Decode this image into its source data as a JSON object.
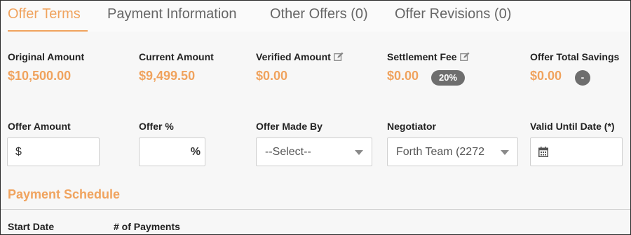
{
  "tabs": [
    {
      "label": "Offer Terms",
      "active": true
    },
    {
      "label": "Payment Information",
      "active": false
    },
    {
      "label": "Other Offers (0)",
      "active": false
    },
    {
      "label": "Offer Revisions (0)",
      "active": false
    }
  ],
  "summary": {
    "original_amount": {
      "label": "Original Amount",
      "value": "$10,500.00"
    },
    "current_amount": {
      "label": "Current Amount",
      "value": "$9,499.50"
    },
    "verified_amount": {
      "label": "Verified Amount",
      "value": "$0.00",
      "icon": "edit-icon"
    },
    "settlement_fee": {
      "label": "Settlement Fee",
      "value": "$0.00",
      "icon": "edit-icon",
      "badge": "20%"
    },
    "offer_total_savings": {
      "label": "Offer Total Savings",
      "value": "$0.00",
      "action": "-"
    }
  },
  "form": {
    "offer_amount": {
      "label": "Offer Amount",
      "prefix": "$",
      "value": ""
    },
    "offer_percent": {
      "label": "Offer %",
      "suffix": "%",
      "value": ""
    },
    "offer_made_by": {
      "label": "Offer Made By",
      "selected": "--Select--"
    },
    "negotiator": {
      "label": "Negotiator",
      "selected": "Forth Team (2272"
    },
    "valid_until_date": {
      "label": "Valid Until Date (*)",
      "icon": "calendar-icon",
      "value": ""
    }
  },
  "payment_schedule": {
    "title": "Payment Schedule",
    "columns": [
      "Start Date",
      "# of Payments"
    ]
  },
  "colors": {
    "accent": "#f0a35e",
    "badge": "#6e6e6e",
    "border": "#cfcfcf"
  }
}
